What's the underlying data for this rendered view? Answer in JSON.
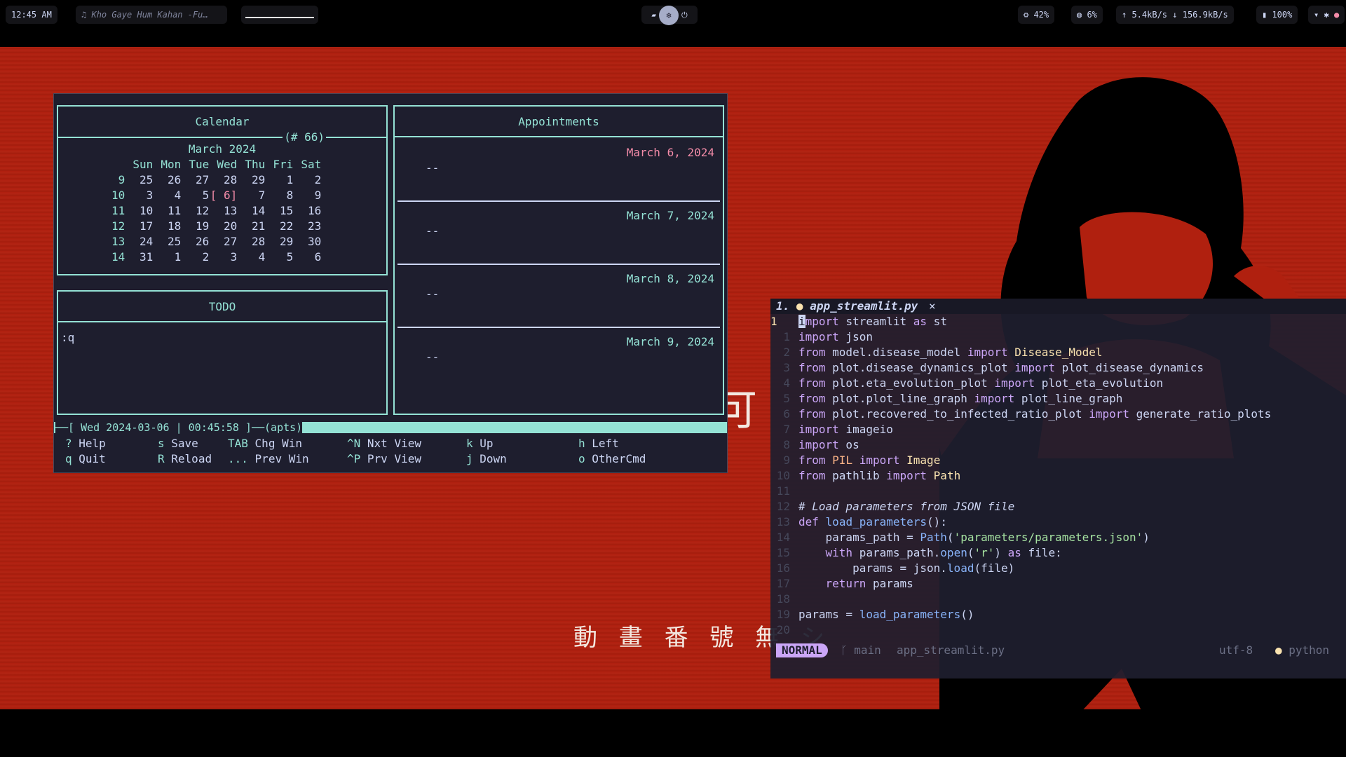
{
  "topbar": {
    "clock": "12:45 AM",
    "media": "Kho Gaye Hum Kahan -Fu…",
    "cpu": "42%",
    "memory": "6%",
    "net_up": "5.4kB/s",
    "net_down": "156.9kB/s",
    "battery": "100%"
  },
  "wallpaper": {
    "kanji_bottom": "動 畫 番 號  無 シ",
    "kanji_mid": "可"
  },
  "calcurse": {
    "calendar_title": "Calendar",
    "calendar_counter": "(# 66)",
    "month": "March 2024",
    "weekdays": [
      "Sun",
      "Mon",
      "Tue",
      "Wed",
      "Thu",
      "Fri",
      "Sat"
    ],
    "weeks": [
      {
        "wk": "9",
        "days": [
          "25",
          "26",
          "27",
          "28",
          "29",
          "1",
          "2"
        ]
      },
      {
        "wk": "10",
        "days": [
          "3",
          "4",
          "5",
          "[ 6]",
          "7",
          "8",
          "9"
        ]
      },
      {
        "wk": "11",
        "days": [
          "10",
          "11",
          "12",
          "13",
          "14",
          "15",
          "16"
        ]
      },
      {
        "wk": "12",
        "days": [
          "17",
          "18",
          "19",
          "20",
          "21",
          "22",
          "23"
        ]
      },
      {
        "wk": "13",
        "days": [
          "24",
          "25",
          "26",
          "27",
          "28",
          "29",
          "30"
        ]
      },
      {
        "wk": "14",
        "days": [
          "31",
          "1",
          "2",
          "3",
          "4",
          "5",
          "6"
        ]
      }
    ],
    "todo_title": "TODO",
    "todo_text": ":q",
    "appointments_title": "Appointments",
    "appointments": [
      {
        "date": "March  6, 2024",
        "entry": "--"
      },
      {
        "date": "March  7, 2024",
        "entry": "--"
      },
      {
        "date": "March  8, 2024",
        "entry": "--"
      },
      {
        "date": "March  9, 2024",
        "entry": "--"
      }
    ],
    "status_prefix": "──[ ",
    "status_datetime": "Wed 2024-03-06 | 00:45:58",
    "status_suffix": " ]──(apts)",
    "keys_row1": [
      {
        "k": "?",
        "d": "Help"
      },
      {
        "k": "s",
        "d": "Save"
      },
      {
        "k": "TAB",
        "d": "Chg Win"
      },
      {
        "k": "^N",
        "d": "Nxt View"
      },
      {
        "k": "k",
        "d": "Up"
      },
      {
        "k": "h",
        "d": "Left"
      }
    ],
    "keys_row2": [
      {
        "k": "q",
        "d": "Quit"
      },
      {
        "k": "R",
        "d": "Reload"
      },
      {
        "k": "...",
        "d": "Prev Win"
      },
      {
        "k": "^P",
        "d": "Prv View"
      },
      {
        "k": "j",
        "d": "Down"
      },
      {
        "k": "o",
        "d": "OtherCmd"
      }
    ]
  },
  "nvim": {
    "tab_index": "1.",
    "tab_name": "app_streamlit.py",
    "tab_close": "×",
    "mode": "NORMAL",
    "branch": "main",
    "file": "app_streamlit.py",
    "encoding": "utf-8",
    "filetype": "python",
    "line_numbers": [
      "1",
      "1",
      "2",
      "3",
      "4",
      "5",
      "6",
      "7",
      "8",
      "9",
      "10",
      "11",
      "12",
      "13",
      "14",
      "15",
      "16",
      "17",
      "18",
      "19",
      "20"
    ],
    "code": [
      "import streamlit as st",
      "import json",
      "from model.disease_model import Disease_Model",
      "from plot.disease_dynamics_plot import plot_disease_dynamics",
      "from plot.eta_evolution_plot import plot_eta_evolution",
      "from plot.plot_line_graph import plot_line_graph",
      "from plot.recovered_to_infected_ratio_plot import generate_ratio_plots",
      "import imageio",
      "import os",
      "from PIL import Image",
      "from pathlib import Path",
      "",
      "# Load parameters from JSON file",
      "def load_parameters():",
      "    params_path = Path('parameters/parameters.json')",
      "    with params_path.open('r') as file:",
      "        params = json.load(file)",
      "    return params",
      "",
      "params = load_parameters()",
      ""
    ]
  }
}
